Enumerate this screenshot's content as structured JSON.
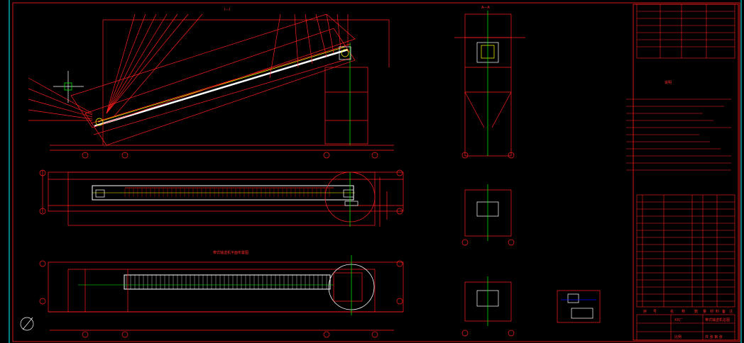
{
  "colors": {
    "background": "#000000",
    "outline": "#ff1e1e",
    "text": "#ffffff",
    "belt": "#ffff00",
    "centerline": "#00ff00",
    "frame": "#00ffff",
    "marker": "#ff00ff",
    "accent": "#0000ff"
  },
  "drawing": {
    "top_label": "I—I",
    "section_a_label": "A—A",
    "plan_view_title": "带式输送机平面布置图",
    "notes_title": "说明",
    "parts_header": [
      "序",
      "号",
      "名",
      "称",
      "数",
      "量",
      "材",
      "料",
      "备",
      "注"
    ],
    "title_block": {
      "company": "XX厂",
      "drawing_title": "带式输送机总图",
      "scale_label": "比例",
      "sheet_label": "共 张 第 张"
    }
  },
  "views": [
    {
      "name": "elevation",
      "type": "inclined-conveyor"
    },
    {
      "name": "plan-upper",
      "type": "conveyor-plan"
    },
    {
      "name": "plan-lower",
      "type": "conveyor-plan"
    },
    {
      "name": "section-a-a",
      "type": "cross-section"
    },
    {
      "name": "detail-1",
      "type": "detail"
    },
    {
      "name": "detail-2",
      "type": "detail"
    },
    {
      "name": "detail-3",
      "type": "detail"
    }
  ]
}
